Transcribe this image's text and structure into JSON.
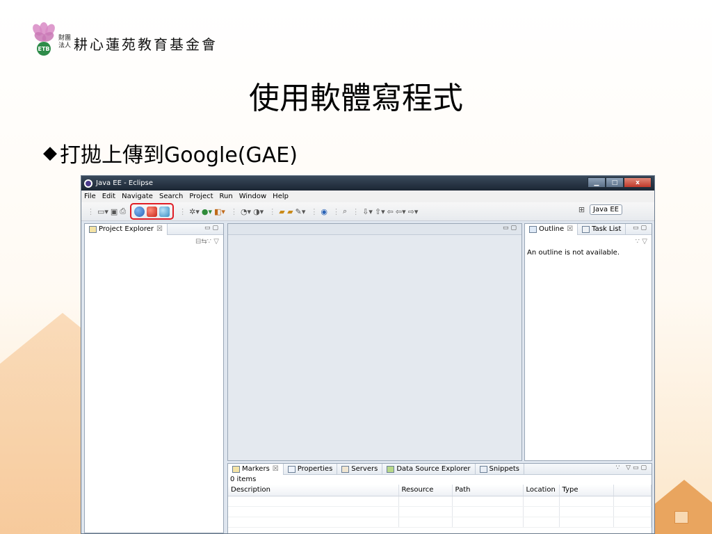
{
  "logo": {
    "small_top": "財團",
    "small_bottom": "法人",
    "org_name": "耕心蓮苑教育基金會",
    "mark_text": "ETB"
  },
  "slide": {
    "title": "使用軟體寫程式",
    "bullet_symbol": "◆",
    "bullet_text": "打拋上傳到Google(GAE)"
  },
  "window": {
    "title": "Java EE - Eclipse",
    "controls": {
      "minimize": "▁",
      "maximize": "□",
      "close": "x"
    },
    "menu": [
      "File",
      "Edit",
      "Navigate",
      "Search",
      "Project",
      "Run",
      "Window",
      "Help"
    ],
    "perspective_label": "Java EE",
    "toolbar_icons": [
      "new-icon",
      "save-icon",
      "print-icon",
      "gae-deploy-icon",
      "gae-project-icon",
      "gae-app-icon",
      "debug-icon",
      "run-icon",
      "external-tools-icon",
      "new-server-icon",
      "open-type-icon",
      "search-icon",
      "globe-icon",
      "back-icon",
      "forward-icon"
    ]
  },
  "explorer": {
    "tab_label": "Project Explorer",
    "close_glyph": "☒"
  },
  "outline": {
    "tab_label": "Outline",
    "tab2_label": "Task List",
    "close_glyph": "☒",
    "message": "An outline is not available."
  },
  "markers": {
    "tabs": [
      {
        "label": "Markers",
        "close": "☒"
      },
      {
        "label": "Properties"
      },
      {
        "label": "Servers"
      },
      {
        "label": "Data Source Explorer"
      },
      {
        "label": "Snippets"
      }
    ],
    "count": "0 items",
    "columns": [
      "Description",
      "Resource",
      "Path",
      "Location",
      "Type"
    ]
  }
}
